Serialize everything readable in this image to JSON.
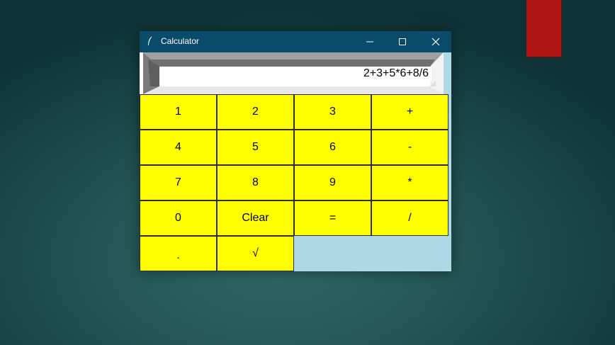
{
  "window": {
    "title": "Calculator"
  },
  "display": {
    "expression": "2+3+5*6+8/6"
  },
  "keys": [
    {
      "label": "1",
      "name": "key-1"
    },
    {
      "label": "2",
      "name": "key-2"
    },
    {
      "label": "3",
      "name": "key-3"
    },
    {
      "label": "+",
      "name": "key-plus"
    },
    {
      "label": "4",
      "name": "key-4"
    },
    {
      "label": "5",
      "name": "key-5"
    },
    {
      "label": "6",
      "name": "key-6"
    },
    {
      "label": "-",
      "name": "key-minus"
    },
    {
      "label": "7",
      "name": "key-7"
    },
    {
      "label": "8",
      "name": "key-8"
    },
    {
      "label": "9",
      "name": "key-9"
    },
    {
      "label": "*",
      "name": "key-multiply"
    },
    {
      "label": "0",
      "name": "key-0"
    },
    {
      "label": "Clear",
      "name": "key-clear"
    },
    {
      "label": "=",
      "name": "key-equals"
    },
    {
      "label": "/",
      "name": "key-divide"
    },
    {
      "label": ".",
      "name": "key-decimal"
    },
    {
      "label": "√",
      "name": "key-sqrt"
    }
  ],
  "icons": {
    "app": "feather-icon",
    "minimize": "minimize-icon",
    "maximize": "maximize-icon",
    "close": "close-icon"
  },
  "colors": {
    "titlebar": "#0a4a6b",
    "window_bg": "#add8e6",
    "key_bg": "#ffff00",
    "desktop_accent": "#b01515"
  }
}
